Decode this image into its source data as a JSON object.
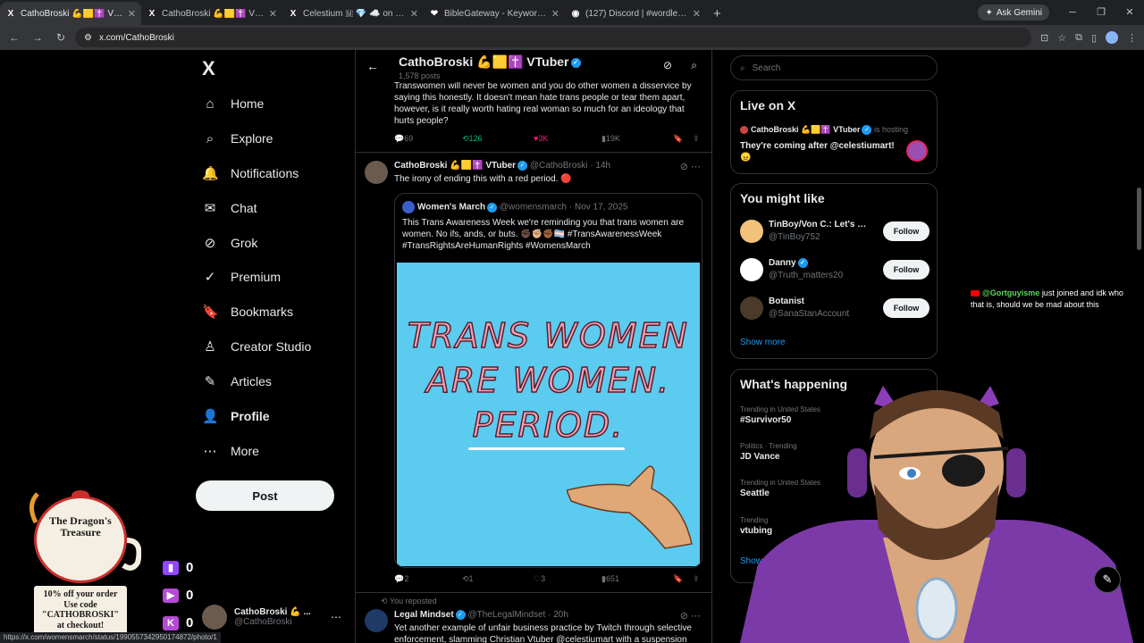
{
  "browser": {
    "tabs": [
      {
        "title": "CathoBroski 💪🟨✝️ VTuber (@...",
        "favicon": "X",
        "active": true
      },
      {
        "title": "CathoBroski 💪🟨✝️ VTuber on",
        "favicon": "X",
        "active": false
      },
      {
        "title": "Celestium 🇲 💎 ☁️ on X: \"@al",
        "favicon": "X",
        "active": false
      },
      {
        "title": "BibleGateway - Keyword Search",
        "favicon": "❤",
        "active": false
      },
      {
        "title": "(127) Discord | #wordle-addicts",
        "favicon": "◉",
        "active": false
      }
    ],
    "new_tab": "+",
    "ask_gemini": "Ask Gemini",
    "url": "x.com/CathoBroski",
    "status_url": "https://x.com/womensmarch/status/1990557342950174872/photo/1"
  },
  "nav": {
    "logo": "X",
    "items": [
      {
        "label": "Home",
        "icon": "⌂"
      },
      {
        "label": "Explore",
        "icon": "⌕"
      },
      {
        "label": "Notifications",
        "icon": "🔔"
      },
      {
        "label": "Chat",
        "icon": "✉"
      },
      {
        "label": "Grok",
        "icon": "⊘"
      },
      {
        "label": "Premium",
        "icon": "✓"
      },
      {
        "label": "Bookmarks",
        "icon": "🔖"
      },
      {
        "label": "Creator Studio",
        "icon": "♙"
      },
      {
        "label": "Articles",
        "icon": "✎"
      },
      {
        "label": "Profile",
        "icon": "👤"
      },
      {
        "label": "More",
        "icon": "⋯"
      }
    ],
    "post_button": "Post",
    "account_name": "CathoBroski 💪 ...",
    "account_handle": "@CathoBroski"
  },
  "overlay": {
    "teapot_text": "The Dragon's Treasure",
    "promo": [
      "10% off your order",
      "Use code",
      "\"CATHOBROSKI\"",
      "at checkout!"
    ],
    "socials": [
      {
        "platform": "twitch",
        "count": "0",
        "color": "#9146ff"
      },
      {
        "platform": "youtube",
        "count": "0",
        "color": "#b64ad6"
      },
      {
        "platform": "kick",
        "count": "0",
        "color": "#b64ad6"
      }
    ],
    "chat": {
      "user": "@Gortguyisme",
      "message": "just joined and idk who that is, should we be mad about this"
    }
  },
  "header": {
    "name": "CathoBroski 💪🟨✝️ VTuber",
    "posts": "1,578 posts"
  },
  "post1": {
    "text": "Transwomen will never be women and you do other women a disservice by saying this honestly. It doesn't mean hate trans people or tear them apart, however, is it really worth hating real woman so much for an ideology that hurts people?",
    "replies": "69",
    "reposts": "126",
    "likes": "3K",
    "views": "19K"
  },
  "post2": {
    "author": "CathoBroski 💪🟨✝️ VTuber",
    "handle": "@CathoBroski",
    "time": "14h",
    "text": "The irony of ending this with a red period. 🔴",
    "quote": {
      "author": "Women's March",
      "handle": "@womensmarch",
      "date": "Nov 17, 2025",
      "text": "This Trans Awareness Week we're reminding you that trans women are women. No ifs, ands, or buts. ✊🏿✊🏼✊🏾🏳️‍⚧️ #TransAwarenessWeek #TransRightsAreHumanRights #WomensMarch",
      "image_lines": [
        "TRANS WOMEN",
        "ARE WOMEN.",
        "PERIOD."
      ]
    },
    "replies": "2",
    "reposts": "1",
    "likes": "3",
    "views": "651"
  },
  "post3": {
    "reposted_by": "You reposted",
    "author": "Legal Mindset",
    "handle": "@TheLegalMindset",
    "time": "20h",
    "text": "Yet another example of unfair business practice by Twitch through selective enforcement, slamming Christian Vtuber @celestiumart with a suspension"
  },
  "right": {
    "search_placeholder": "Search",
    "live": {
      "title": "Live on X",
      "host": "CathoBroski 💪🟨✝️ VTuber",
      "hosting": "is hosting",
      "space_title": "They're coming after @celestiumart! 😠"
    },
    "might_like": {
      "title": "You might like",
      "users": [
        {
          "name": "TinBoy/Von C.: Let's Pl...",
          "handle": "@TinBoy752",
          "follow": "Follow",
          "color": "#f2c27b"
        },
        {
          "name": "Danny",
          "handle": "@Truth_matters20",
          "follow": "Follow",
          "color": "#ffffff"
        },
        {
          "name": "Botanist",
          "handle": "@SanaStanAccount",
          "follow": "Follow",
          "color": "#4a3a2a"
        }
      ],
      "show_more": "Show more"
    },
    "happening": {
      "title": "What's happening",
      "trends": [
        {
          "category": "Trending in United States",
          "name": "#Survivor50"
        },
        {
          "category": "Politics · Trending",
          "name": "JD Vance"
        },
        {
          "category": "Trending in United States",
          "name": "Seattle"
        },
        {
          "category": "Trending",
          "name": "vtubing"
        }
      ],
      "show_more": "Show more"
    }
  }
}
